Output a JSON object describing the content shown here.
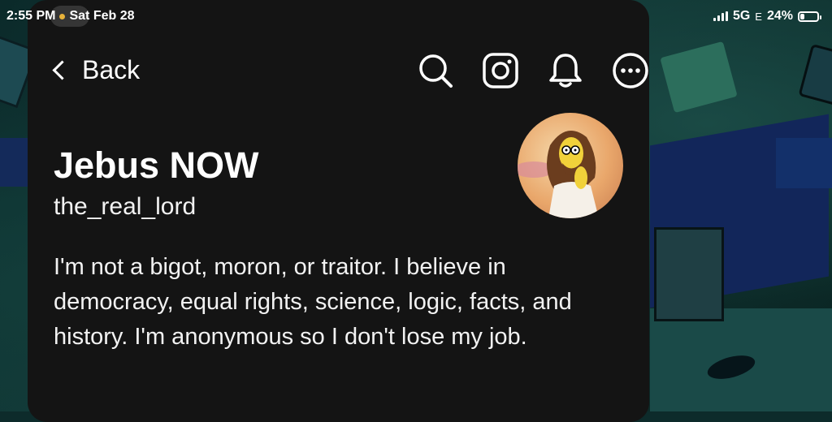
{
  "status": {
    "time": "2:55 PM",
    "date": "Sat Feb 28",
    "network": "5G",
    "network_suffix": "E",
    "battery_percent": "24%",
    "battery_level": 0.24
  },
  "nav": {
    "back_label": "Back",
    "icons": [
      "search-icon",
      "instagram-icon",
      "bell-icon",
      "more-icon"
    ]
  },
  "profile": {
    "display_name": "Jebus NOW",
    "username": "the_real_lord",
    "bio": "I'm not a bigot, moron, or traitor. I believe in democracy, equal rights, science, logic, facts, and history. I'm anonymous so I don't lose my job."
  },
  "colors": {
    "card_bg": "#141414",
    "text": "#ffffff",
    "status_dot": "#e8b23a"
  }
}
